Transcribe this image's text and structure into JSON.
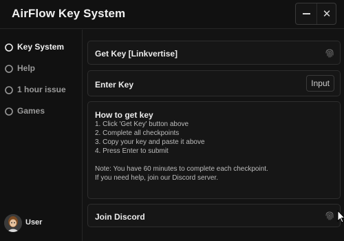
{
  "window": {
    "title": "AirFlow Key System"
  },
  "titlebar": {
    "minimize_icon": "minimize-icon",
    "close_icon": "close-icon",
    "close_glyph": "✕"
  },
  "sidebar": {
    "items": [
      {
        "label": "Key System",
        "icon": "circle-outline-icon",
        "active": true
      },
      {
        "label": "Help",
        "icon": "circle-outline-icon",
        "active": false
      },
      {
        "label": "1 hour issue",
        "icon": "circle-outline-icon",
        "active": false
      },
      {
        "label": "Games",
        "icon": "circle-outline-icon",
        "active": false
      }
    ],
    "user": {
      "label": "User",
      "avatar_icon": "avatar-icon"
    }
  },
  "main": {
    "get_key": {
      "label": "Get Key [Linkvertise]",
      "icon": "fingerprint-icon"
    },
    "enter_key": {
      "label": "Enter Key",
      "input_label": "Input"
    },
    "info": {
      "title": "How to get key",
      "lines": [
        "1. Click 'Get Key' button above",
        "2. Complete all checkpoints",
        "3. Copy your key and paste it above",
        "4. Press Enter to submit",
        "",
        "Note: You have 60 minutes to complete each checkpoint.",
        "If you need help, join our Discord server."
      ]
    },
    "join_discord": {
      "label": "Join Discord",
      "icon": "fingerprint-icon"
    }
  },
  "colors": {
    "background": "#131313",
    "card": "#161616",
    "border": "#2e2e2e",
    "text_primary": "#ececec",
    "text_muted": "#9a9a9a"
  }
}
